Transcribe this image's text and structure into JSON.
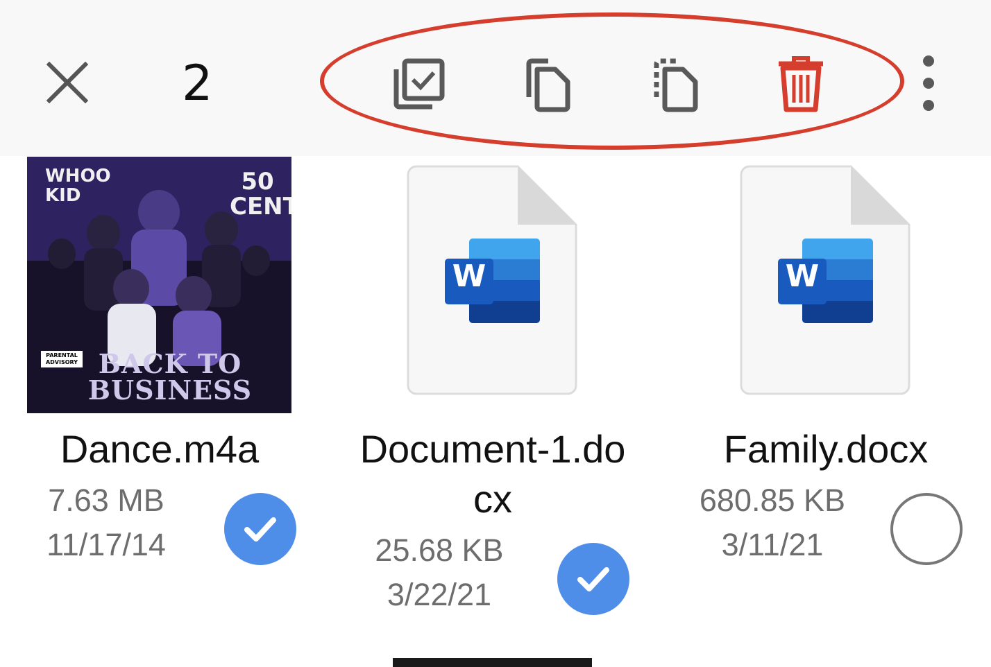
{
  "toolbar": {
    "selected_count": "2",
    "close_icon": "close-icon",
    "actions": [
      {
        "name": "select-all-icon"
      },
      {
        "name": "copy-icon"
      },
      {
        "name": "move-icon"
      },
      {
        "name": "delete-icon",
        "color": "#d53d2d"
      }
    ],
    "more_icon": "more-vertical-icon",
    "highlight_color": "#d53d2d"
  },
  "files": [
    {
      "name": "Dance.m4a",
      "size": "7.63 MB",
      "date": "11/17/14",
      "selected": true,
      "thumbnail": {
        "type": "album-art",
        "text_top_left": "WHOO KID",
        "text_top_right": "50 CENT",
        "title": "BACK TO BUSINESS",
        "advisory": "PARENTAL ADVISORY"
      }
    },
    {
      "name_line1": "Document-1.do",
      "name_line2": "cx",
      "size": "25.68 KB",
      "date": "3/22/21",
      "selected": true,
      "thumbnail": {
        "type": "word-doc",
        "letter": "W"
      }
    },
    {
      "name": "Family.docx",
      "size": "680.85 KB",
      "date": "3/11/21",
      "selected": false,
      "thumbnail": {
        "type": "word-doc",
        "letter": "W"
      }
    }
  ],
  "colors": {
    "accent": "#4f8ee8",
    "toolbar_bg": "#f8f8f8",
    "icon_gray": "#595959",
    "word_blue": "#2b579a"
  }
}
